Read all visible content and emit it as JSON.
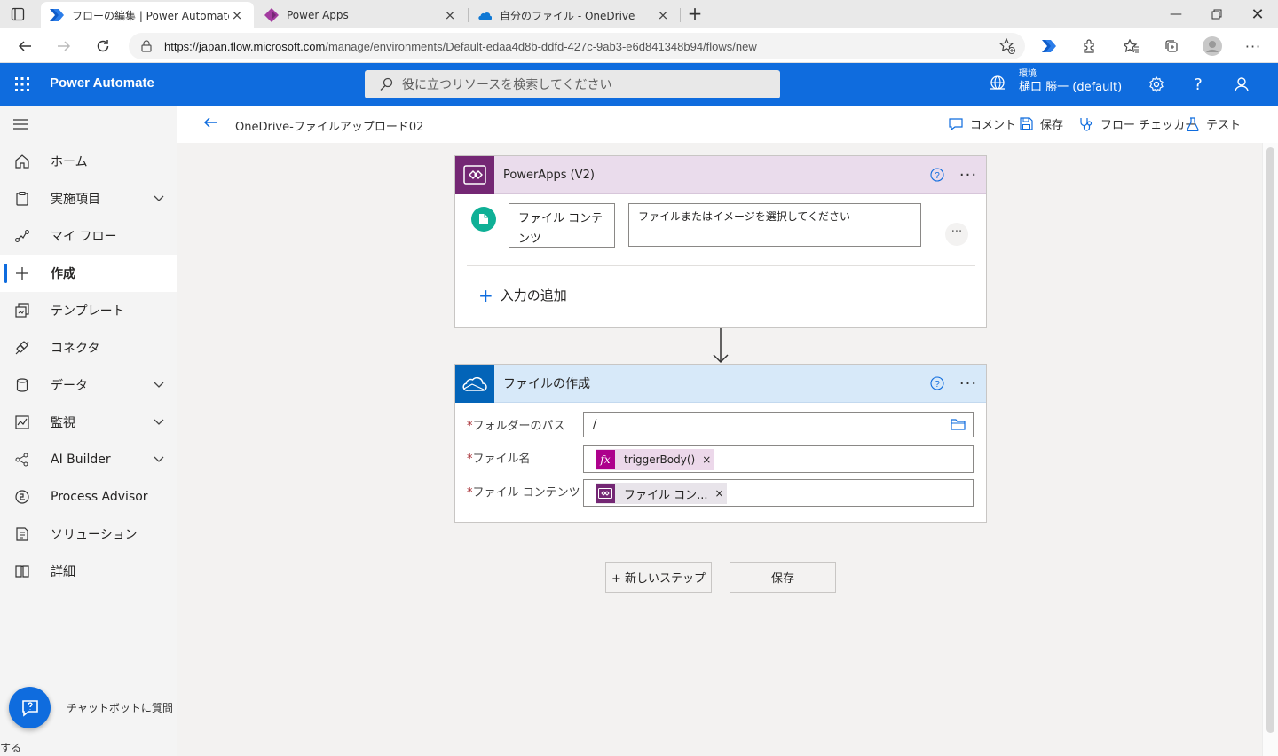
{
  "browser": {
    "tabs": [
      {
        "title": "フローの編集 | Power Automate",
        "icon": "power-automate-icon"
      },
      {
        "title": "Power Apps",
        "icon": "power-apps-icon"
      },
      {
        "title": "自分のファイル - OneDrive",
        "icon": "onedrive-icon"
      }
    ],
    "url_host": "https://japan.flow.microsoft.com",
    "url_path": "/manage/environments/Default-edaa4d8b-ddfd-427c-9ab3-e6d841348b94/flows/new"
  },
  "header": {
    "app_name": "Power Automate",
    "search_placeholder": "役に立つリソースを検索してください",
    "env_label": "環境",
    "env_value": "樋口 勝一 (default)"
  },
  "sidebar": {
    "items": [
      {
        "label": "ホーム",
        "icon": "home-icon",
        "chevron": false
      },
      {
        "label": "実施項目",
        "icon": "clipboard-icon",
        "chevron": true
      },
      {
        "label": "マイ フロー",
        "icon": "flow-icon",
        "chevron": false
      },
      {
        "label": "作成",
        "icon": "plus-icon",
        "chevron": false,
        "selected": true
      },
      {
        "label": "テンプレート",
        "icon": "template-icon",
        "chevron": false
      },
      {
        "label": "コネクタ",
        "icon": "connector-icon",
        "chevron": false
      },
      {
        "label": "データ",
        "icon": "database-icon",
        "chevron": true
      },
      {
        "label": "監視",
        "icon": "monitor-icon",
        "chevron": true
      },
      {
        "label": "AI Builder",
        "icon": "ai-builder-icon",
        "chevron": true
      },
      {
        "label": "Process Advisor",
        "icon": "process-advisor-icon",
        "chevron": false
      },
      {
        "label": "ソリューション",
        "icon": "solution-icon",
        "chevron": false
      },
      {
        "label": "詳細",
        "icon": "book-icon",
        "chevron": false
      }
    ],
    "chatbot_label_1": "チャットボットに質問",
    "chatbot_label_2": "する"
  },
  "commandbar": {
    "flow_name": "OneDrive-ファイルアップロード02",
    "comment": "コメント",
    "save": "保存",
    "flow_checker": "フロー チェッカー",
    "test": "テスト"
  },
  "trigger_card": {
    "title": "PowerApps (V2)",
    "input_name": "ファイル コンテンツ",
    "input_placeholder": "ファイルまたはイメージを選択してください",
    "add_input": "入力の追加",
    "accent": "#742774"
  },
  "action_card": {
    "title": "ファイルの作成",
    "folder_label": "フォルダーのパス",
    "folder_value": "/",
    "filename_label": "ファイル名",
    "filename_token": "triggerBody()",
    "content_label": "ファイル コンテンツ",
    "content_token": "ファイル コン...",
    "accent": "#0364b8"
  },
  "footer_buttons": {
    "new_step": "+ 新しいステップ",
    "save": "保存"
  }
}
